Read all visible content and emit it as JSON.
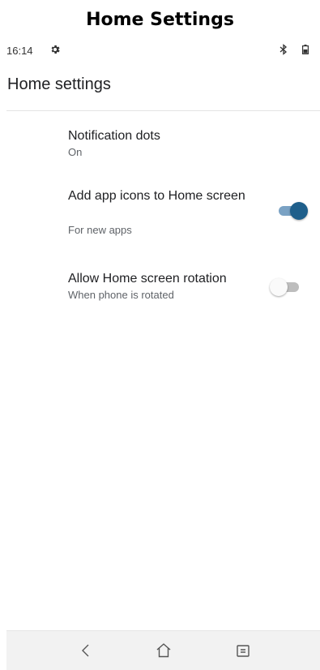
{
  "caption": "Home Settings",
  "status_bar": {
    "time": "16:14",
    "icons": [
      "gear-icon",
      "bluetooth-icon",
      "battery-icon"
    ]
  },
  "app_bar": {
    "title": "Home settings"
  },
  "settings": [
    {
      "title": "Notification dots",
      "subtitle": "On",
      "has_switch": false
    },
    {
      "title": "Add app icons to Home screen",
      "subtitle": "For new apps",
      "has_switch": true,
      "switch_on": true
    },
    {
      "title": "Allow Home screen rotation",
      "subtitle": "When phone is rotated",
      "has_switch": true,
      "switch_on": false
    }
  ],
  "nav_bar": {
    "icons": [
      "back-icon",
      "home-icon",
      "recents-icon"
    ]
  },
  "colors": {
    "switch_on_thumb": "#1f5f8b",
    "switch_on_track": "#7aa2c4",
    "switch_off_thumb": "#fafafa",
    "switch_off_track": "#bdbdbd"
  }
}
